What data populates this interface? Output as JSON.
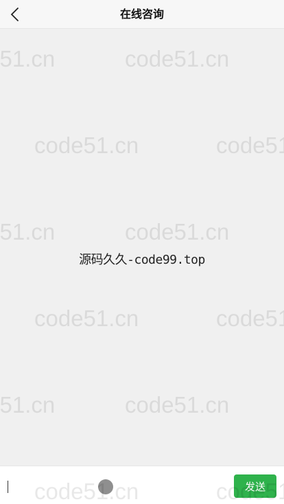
{
  "header": {
    "title": "在线咨询",
    "back_icon": "chevron-left-icon"
  },
  "chat": {
    "center_text": "源码久久-code99.top",
    "watermark_text": "code51.cn"
  },
  "composer": {
    "input_value": "",
    "send_label": "发送"
  },
  "colors": {
    "send_button": "#2fb24c",
    "header_bg": "#f7f7f7",
    "chat_bg": "#f0f0f0"
  }
}
